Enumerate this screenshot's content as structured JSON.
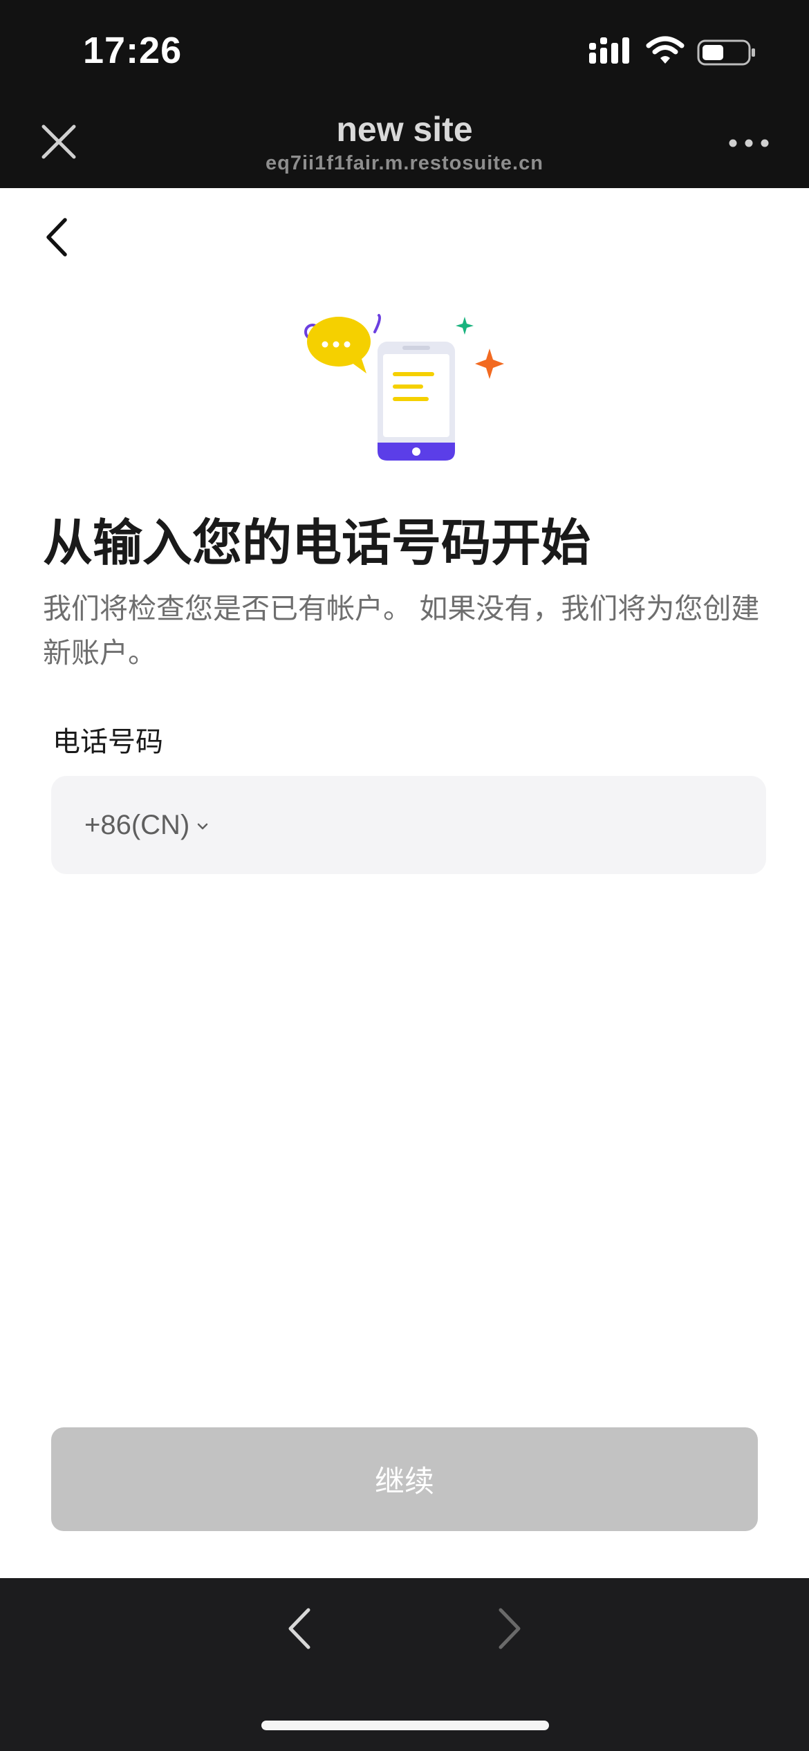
{
  "status_bar": {
    "time": "17:26"
  },
  "browser_header": {
    "title": "new site",
    "url": "eq7ii1f1fair.m.restosuite.cn",
    "close_icon": "close-icon",
    "more_icon": "more-dots-icon"
  },
  "page": {
    "back_icon": "chevron-left-icon",
    "heading": "从输入您的电话号码开始",
    "subtitle": "我们将检查您是否已有帐户。 如果没有，我们将为您创建新账户。",
    "phone_label": "电话号码",
    "country_code": "+86(CN)",
    "phone_value": "",
    "continue_label": "继续"
  },
  "browser_footer": {
    "back_icon": "chevron-left-icon",
    "forward_icon": "chevron-right-icon"
  },
  "colors": {
    "top_bar": "#121212",
    "bottom_bar": "#1c1c1e",
    "input_bg": "#f4f4f6",
    "button_disabled": "#c2c2c2",
    "accent_purple": "#5b3ee8",
    "accent_yellow": "#f5d000",
    "accent_orange": "#f26a21",
    "accent_green": "#19b37e"
  }
}
